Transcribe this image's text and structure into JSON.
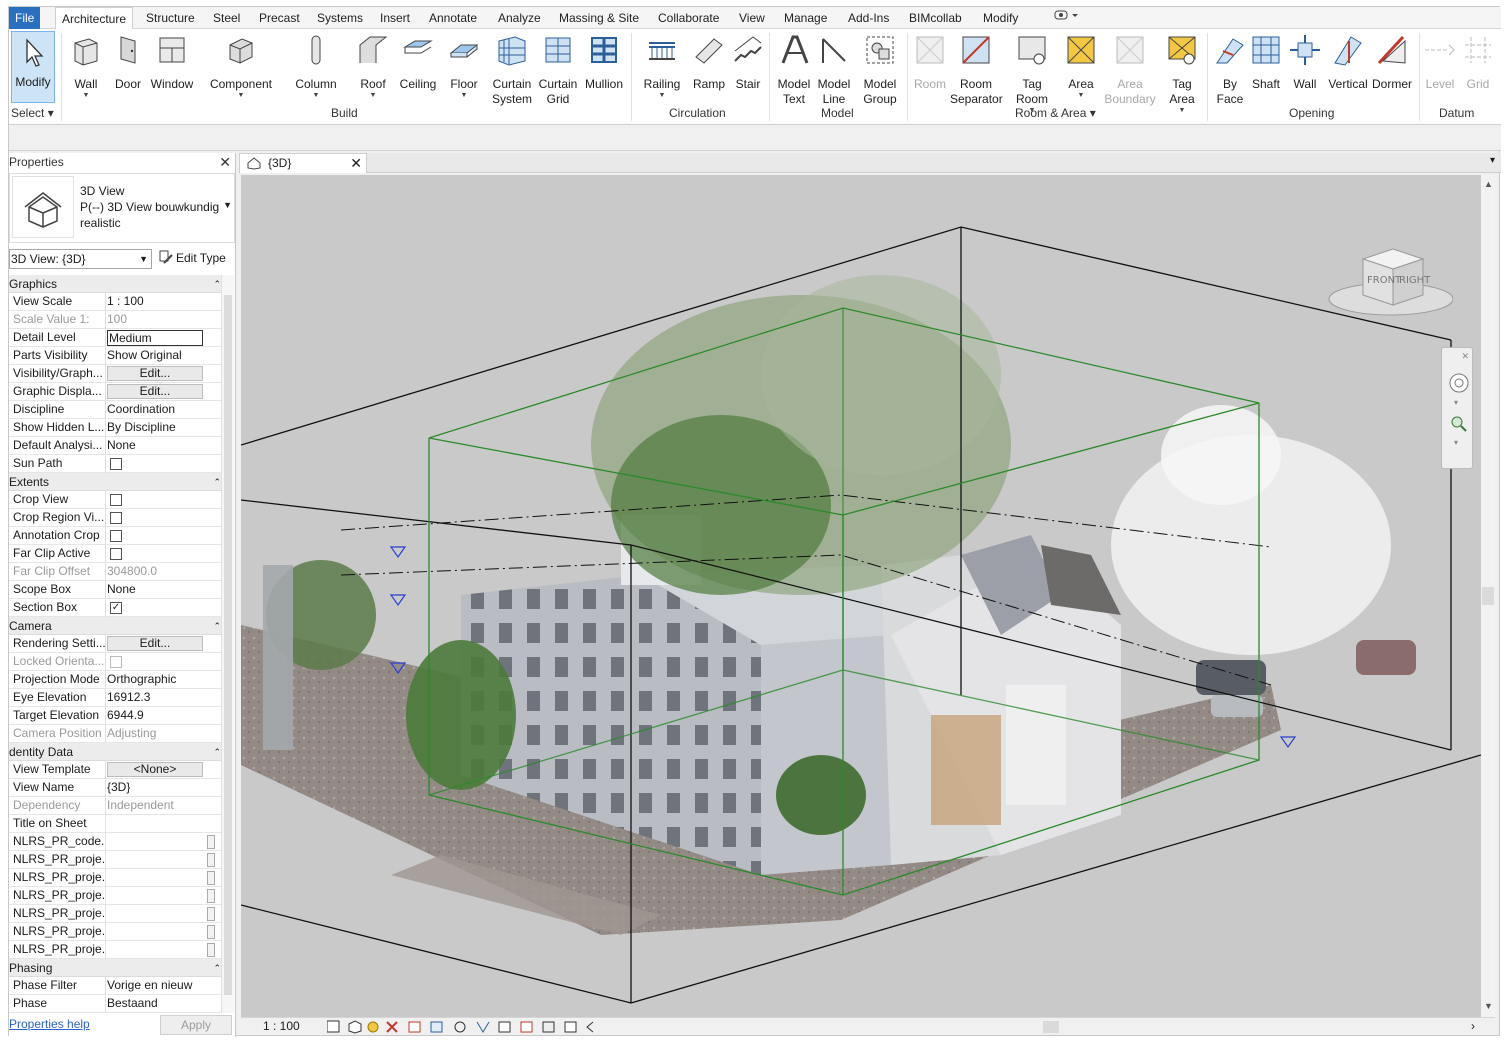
{
  "menu": {
    "tabs": [
      "File",
      "Architecture",
      "Structure",
      "Steel",
      "Precast",
      "Systems",
      "Insert",
      "Annotate",
      "Analyze",
      "Massing & Site",
      "Collaborate",
      "View",
      "Manage",
      "Add-Ins",
      "BIMcollab",
      "Modify"
    ]
  },
  "ribbon": {
    "select": {
      "modify_label": "Modify",
      "select_label": "Select"
    },
    "build": {
      "label": "Build",
      "buttons": [
        "Wall",
        "Door",
        "Window",
        "Component",
        "Column",
        "Roof",
        "Ceiling",
        "Floor",
        "Curtain System",
        "Curtain Grid",
        "Mullion"
      ]
    },
    "circulation": {
      "label": "Circulation",
      "buttons": [
        "Railing",
        "Ramp",
        "Stair"
      ]
    },
    "model": {
      "label": "Model",
      "buttons": [
        "Model Text",
        "Model Line",
        "Model Group"
      ]
    },
    "room_area": {
      "label": "Room & Area",
      "buttons": [
        "Room",
        "Room Separator",
        "Tag Room",
        "Area",
        "Area Boundary",
        "Tag Area"
      ]
    },
    "opening": {
      "label": "Opening",
      "buttons": [
        "By Face",
        "Shaft",
        "Wall",
        "Vertical",
        "Dormer"
      ]
    },
    "datum": {
      "label": "Datum",
      "buttons": [
        "Level",
        "Grid"
      ]
    }
  },
  "properties": {
    "title": "Properties",
    "type_line1": "3D View",
    "type_line2": "P(--) 3D View bouwkundig",
    "type_line3": "realistic",
    "view_selector": "3D View: {3D}",
    "edit_type": "Edit Type",
    "sections": {
      "graphics": "Graphics",
      "extents": "Extents",
      "camera": "Camera",
      "identity": "dentity Data",
      "phasing": "Phasing"
    },
    "graphics_rows": [
      {
        "k": "View Scale",
        "v": "1 : 100"
      },
      {
        "k": "Scale Value    1:",
        "v": "100"
      },
      {
        "k": "Detail Level",
        "v": "Medium"
      },
      {
        "k": "Parts Visibility",
        "v": "Show Original"
      },
      {
        "k": "Visibility/Graph...",
        "v": "Edit..."
      },
      {
        "k": "Graphic Displa...",
        "v": "Edit..."
      },
      {
        "k": "Discipline",
        "v": "Coordination"
      },
      {
        "k": "Show Hidden L...",
        "v": "By Discipline"
      },
      {
        "k": "Default Analysi...",
        "v": "None"
      },
      {
        "k": "Sun Path",
        "v": ""
      }
    ],
    "extents_rows": [
      {
        "k": "Crop View",
        "v": ""
      },
      {
        "k": "Crop Region Vi...",
        "v": ""
      },
      {
        "k": "Annotation Crop",
        "v": ""
      },
      {
        "k": "Far Clip Active",
        "v": ""
      },
      {
        "k": "Far Clip Offset",
        "v": "304800.0"
      },
      {
        "k": "Scope Box",
        "v": "None"
      },
      {
        "k": "Section Box",
        "v": "✓"
      }
    ],
    "camera_rows": [
      {
        "k": "Rendering Setti...",
        "v": "Edit..."
      },
      {
        "k": "Locked Orienta...",
        "v": ""
      },
      {
        "k": "Projection Mode",
        "v": "Orthographic"
      },
      {
        "k": "Eye Elevation",
        "v": "16912.3"
      },
      {
        "k": "Target Elevation",
        "v": "6944.9"
      },
      {
        "k": "Camera Position",
        "v": "Adjusting"
      }
    ],
    "identity_rows": [
      {
        "k": "View Template",
        "v": "<None>"
      },
      {
        "k": "View Name",
        "v": "{3D}"
      },
      {
        "k": "Dependency",
        "v": "Independent"
      },
      {
        "k": "Title on Sheet",
        "v": ""
      },
      {
        "k": "NLRS_PR_code...",
        "v": ""
      },
      {
        "k": "NLRS_PR_proje...",
        "v": ""
      },
      {
        "k": "NLRS_PR_proje...",
        "v": ""
      },
      {
        "k": "NLRS_PR_proje...",
        "v": ""
      },
      {
        "k": "NLRS_PR_proje...",
        "v": ""
      },
      {
        "k": "NLRS_PR_proje...",
        "v": ""
      },
      {
        "k": "NLRS_PR_proje...",
        "v": ""
      }
    ],
    "phasing_rows": [
      {
        "k": "Phase Filter",
        "v": "Vorige en nieuw"
      },
      {
        "k": "Phase",
        "v": "Bestaand"
      }
    ],
    "help_link": "Properties help",
    "apply": "Apply"
  },
  "view": {
    "tab_label": "{3D}",
    "scale": "1 : 100",
    "viewcube_front": "FRONT",
    "viewcube_right": "RIGHT"
  },
  "colors": {
    "file_tab": "#2a6fc0",
    "section_box": "#2a8a2a",
    "viewport_bg": "#c9c9c9"
  }
}
